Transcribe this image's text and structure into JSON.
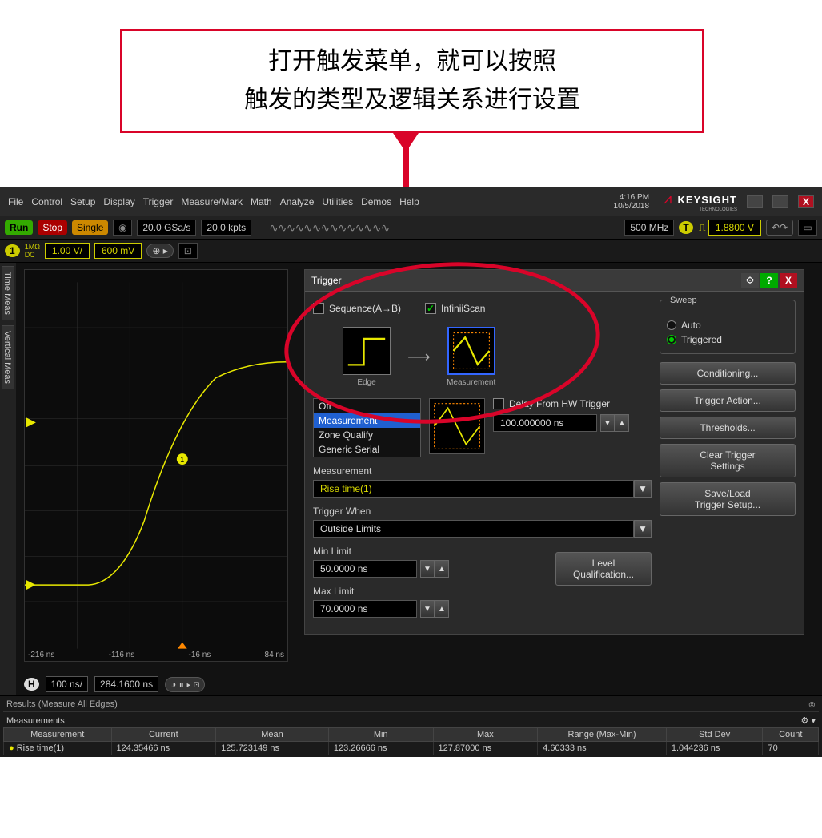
{
  "callout": {
    "line1": "打开触发菜单，就可以按照",
    "line2": "触发的类型及逻辑关系进行设置"
  },
  "menubar": {
    "items": [
      "File",
      "Control",
      "Setup",
      "Display",
      "Trigger",
      "Measure/Mark",
      "Math",
      "Analyze",
      "Utilities",
      "Demos",
      "Help"
    ],
    "time": "4:16 PM",
    "date": "10/5/2018",
    "brand": "KEYSIGHT",
    "brand_sub": "TECHNOLOGIES"
  },
  "toolbar": {
    "run": "Run",
    "stop": "Stop",
    "single": "Single",
    "sample_rate": "20.0 GSa/s",
    "mem_depth": "20.0 kpts",
    "bw": "500 MHz",
    "trigger_level": "1.8800 V"
  },
  "channel": {
    "num": "1",
    "scale": "1.00 V/",
    "offset": "600 mV"
  },
  "waveform": {
    "xticks": [
      "-216 ns",
      "-116 ns",
      "-16 ns",
      "84 ns"
    ]
  },
  "timebase": {
    "badge": "H",
    "scale": "100 ns/",
    "delay": "284.1600 ns"
  },
  "sidebar": {
    "tabs": [
      "Time Meas",
      "Vertical Meas"
    ]
  },
  "dialog": {
    "title": "Trigger",
    "seq_label": "Sequence(A→B)",
    "seq_checked": false,
    "infiniiscan_label": "InfiniiScan",
    "infiniiscan_checked": true,
    "node1_label": "Edge",
    "node2_label": "Measurement",
    "list": [
      "Off",
      "Measurement",
      "Zone Qualify",
      "Generic Serial"
    ],
    "list_selected": "Measurement",
    "delay_label": "Delay From HW Trigger",
    "delay_value": "100.000000 ns",
    "measurement_label": "Measurement",
    "measurement_value": "Rise time(1)",
    "trigger_when_label": "Trigger When",
    "trigger_when_value": "Outside Limits",
    "min_limit_label": "Min Limit",
    "min_limit_value": "50.0000 ns",
    "max_limit_label": "Max Limit",
    "max_limit_value": "70.0000 ns",
    "level_qual_btn": "Level\nQualification...",
    "sweep": {
      "title": "Sweep",
      "auto": "Auto",
      "triggered": "Triggered",
      "selected": "Triggered"
    },
    "side_buttons": [
      "Conditioning...",
      "Trigger Action...",
      "Thresholds...",
      "Clear Trigger\nSettings",
      "Save/Load\nTrigger Setup..."
    ]
  },
  "results": {
    "title": "Results   (Measure All Edges)",
    "meas_title": "Measurements",
    "columns": [
      "Measurement",
      "Current",
      "Mean",
      "Min",
      "Max",
      "Range (Max-Min)",
      "Std Dev",
      "Count"
    ],
    "row": {
      "name": "Rise time(1)",
      "current": "124.35466 ns",
      "mean": "125.723149 ns",
      "min": "123.26666 ns",
      "max": "127.87000 ns",
      "range": "4.60333 ns",
      "stddev": "1.044236 ns",
      "count": "70"
    }
  }
}
